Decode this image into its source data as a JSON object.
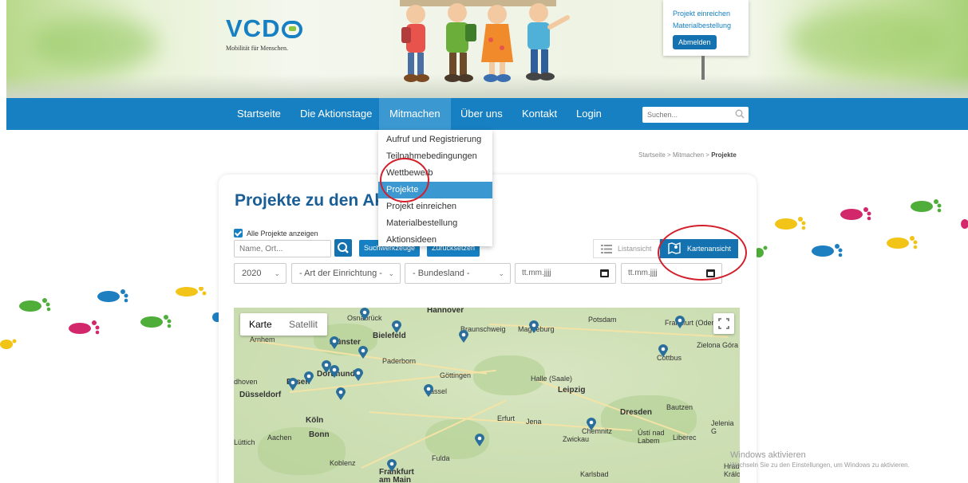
{
  "header": {
    "logo_text": "VCD",
    "logo_subtitle": "Mobilität für Menschen.",
    "user_links": [
      "Projekt einreichen",
      "Materialbestellung"
    ],
    "logout_label": "Abmelden"
  },
  "nav": {
    "items": [
      "Startseite",
      "Die Aktionstage",
      "Mitmachen",
      "Über uns",
      "Kontakt",
      "Login"
    ],
    "active": "Mitmachen",
    "search_placeholder": "Suchen..."
  },
  "dropdown": {
    "items": [
      "Aufruf und Registrierung",
      "Teilnahmebedingungen",
      "Wettbewerb",
      "Projekte",
      "Projekt einreichen",
      "Materialbestellung",
      "Aktionsideen"
    ],
    "selected": "Projekte"
  },
  "breadcrumb": {
    "home": "Startseite",
    "sep": ">",
    "parent": "Mitmachen",
    "current": "Projekte"
  },
  "main": {
    "title": "Projekte zu den Akti",
    "show_all_label": "Alle Projekte anzeigen",
    "name_placeholder": "Name, Ort...",
    "tools_button": "Suchwerkzeuge",
    "reset_button": "Zurücksetzen",
    "list_view_label": "Listansicht",
    "map_view_label": "Kartenansicht",
    "year_select": "2020",
    "type_select": "- Art der Einrichtung -",
    "state_select": "- Bundesland -",
    "date_from_placeholder": "tt.mm.jjjj",
    "date_to_placeholder": "tt.mm.jjjj"
  },
  "map": {
    "tab_map": "Karte",
    "tab_satellite": "Satellit",
    "cities": {
      "hannover": "Hannover",
      "osnabrueck": "Osnabrück",
      "arnhem": "Arnhem",
      "muenster": "Münster",
      "bielefeld": "Bielefeld",
      "braunschweig": "Braunschweig",
      "magdeburg": "Magdeburg",
      "potsdam": "Potsdam",
      "frankfurt_oder": "Frankfurt (Oder)",
      "zielona_gora": "Zielona Góra",
      "paderborn": "Paderborn",
      "dortmund": "Dortmund",
      "cottbus": "Cottbus",
      "eindhoven": "dhoven",
      "essen": "Essen",
      "goettingen": "Göttingen",
      "halle": "Halle (Saale)",
      "duesseldorf": "Düsseldorf",
      "kassel": "Kassel",
      "leipzig": "Leipzig",
      "dresden": "Dresden",
      "bautzen": "Bautzen",
      "koeln": "Köln",
      "erfurt": "Erfurt",
      "jena": "Jena",
      "chemnitz": "Chemnitz",
      "jelenia": "Jelenia G",
      "aachen": "Aachen",
      "bonn": "Bonn",
      "zwickau": "Zwickau",
      "usti": "Ústí nad Labem",
      "liberec": "Liberec",
      "luettich": "Lüttich",
      "fulda": "Fulda",
      "koblenz": "Koblenz",
      "frankfurt": "Frankfurt am Main",
      "karlsbad": "Karlsbad",
      "hradec": "Hradec Králo"
    }
  },
  "watermark": {
    "line1": "Windows aktivieren",
    "line2": "Wechseln Sie zu den Einstellungen, um Windows zu aktivieren."
  },
  "colors": {
    "nav_blue": "#1780c2",
    "title_blue": "#1a5e96",
    "annotation_red": "#d21f2b"
  }
}
